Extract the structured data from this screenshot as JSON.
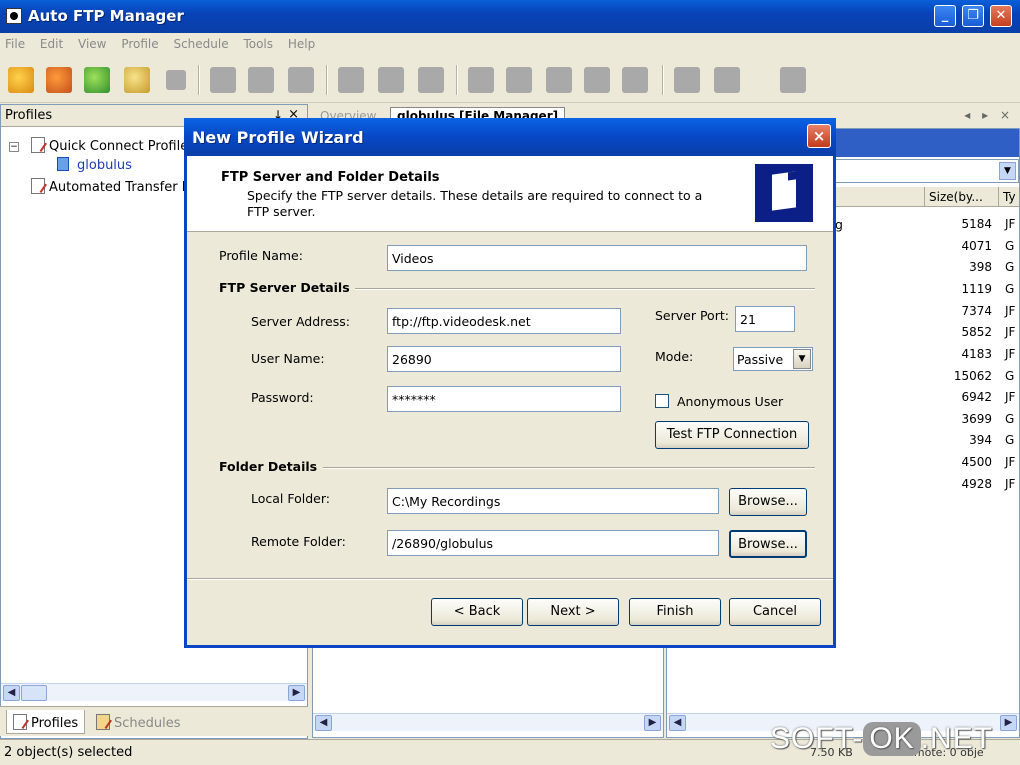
{
  "app": {
    "title": "Auto FTP Manager"
  },
  "menu": [
    "File",
    "Edit",
    "View",
    "Profile",
    "Schedule",
    "Tools",
    "Help"
  ],
  "profiles_panel": {
    "title": "Profiles",
    "pin": "↓",
    "close": "×",
    "tree": {
      "quick_connect": "Quick Connect Profile",
      "globulus": "globulus",
      "automated": "Automated Transfer P"
    },
    "tabs": {
      "profiles": "Profiles",
      "schedules": "Schedules"
    }
  },
  "tabs": {
    "overview": "Overview",
    "file_manager": "globulus [File Manager]",
    "nav": "◂ ▸ ×"
  },
  "right_pane": {
    "col_size": "Size(by...",
    "col_type": "Ty",
    "partial_label": "g",
    "rows": [
      {
        "size": "5184",
        "type": "JF"
      },
      {
        "size": "4071",
        "type": "G"
      },
      {
        "size": "398",
        "type": "G"
      },
      {
        "size": "1119",
        "type": "G"
      },
      {
        "size": "7374",
        "type": "JF"
      },
      {
        "size": "5852",
        "type": "JF"
      },
      {
        "size": "4183",
        "type": "JF"
      },
      {
        "size": "15062",
        "type": "G"
      },
      {
        "size": "6942",
        "type": "JF"
      },
      {
        "size": "3699",
        "type": "G"
      },
      {
        "size": "394",
        "type": "G"
      },
      {
        "size": "4500",
        "type": "JF"
      },
      {
        "size": "4928",
        "type": "JF"
      }
    ]
  },
  "status": {
    "selected": "2 object(s) selected",
    "size": "7.50 KB",
    "remote": "Remote: 0 obje"
  },
  "watermark": {
    "pre": "SOFT-",
    "ok": "OK",
    "post": ".NET"
  },
  "dialog": {
    "title": "New Profile Wizard",
    "close": "×",
    "heading": "FTP Server and Folder Details",
    "subheading": "Specify the FTP server details. These details are required to connect to a FTP server.",
    "profile_name_label": "Profile Name:",
    "profile_name_value": "Videos",
    "ftp_group": "FTP Server Details",
    "server_address_label": "Server Address:",
    "server_address_value": "ftp://ftp.videodesk.net",
    "user_name_label": "User Name:",
    "user_name_value": "26890",
    "password_label": "Password:",
    "password_value": "*******",
    "server_port_label": "Server Port:",
    "server_port_value": "21",
    "mode_label": "Mode:",
    "mode_value": "Passive",
    "anonymous_label": "Anonymous User",
    "test_button": "Test FTP Connection",
    "folder_group": "Folder Details",
    "local_folder_label": "Local Folder:",
    "local_folder_value": "C:\\My Recordings",
    "remote_folder_label": "Remote Folder:",
    "remote_folder_value": "/26890/globulus",
    "browse_label": "Browse...",
    "back_button": "< Back",
    "next_button": "Next >",
    "finish_button": "Finish",
    "cancel_button": "Cancel"
  }
}
